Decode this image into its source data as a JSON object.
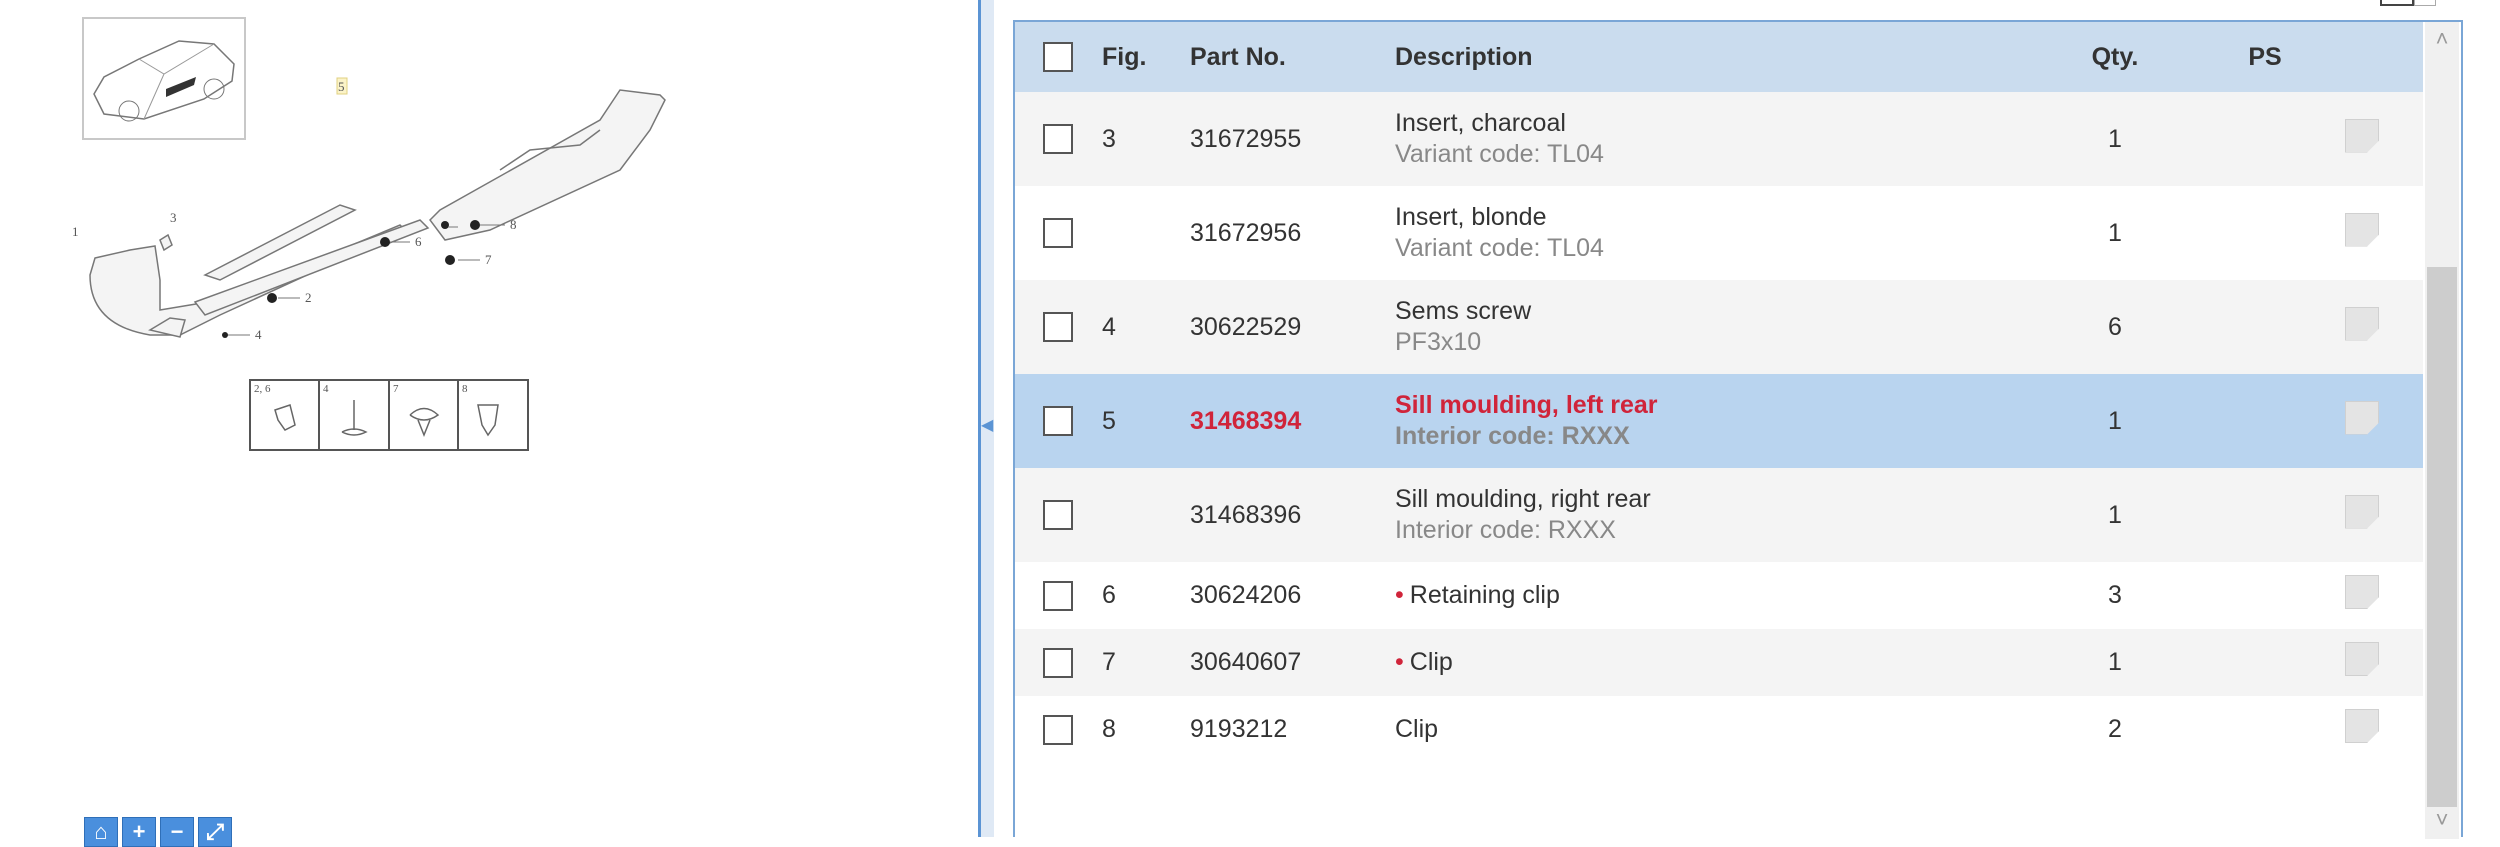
{
  "diagram": {
    "callouts": [
      "1",
      "2",
      "3",
      "4",
      "5",
      "6",
      "7",
      "8"
    ],
    "legend": [
      {
        "label": "2, 6",
        "icon": "retaining-clip-icon"
      },
      {
        "label": "4",
        "icon": "screw-icon"
      },
      {
        "label": "7",
        "icon": "clip-icon"
      },
      {
        "label": "8",
        "icon": "clip-icon"
      }
    ]
  },
  "toolbar": {
    "buttons": [
      {
        "icon": "home-icon",
        "glyph": "⌂"
      },
      {
        "icon": "zoom-in-icon",
        "glyph": "+"
      },
      {
        "icon": "zoom-out-icon",
        "glyph": "−"
      },
      {
        "icon": "fit-icon",
        "glyph": "⤢"
      }
    ]
  },
  "table": {
    "headers": {
      "fig": "Fig.",
      "part_no": "Part No.",
      "description": "Description",
      "qty": "Qty.",
      "ps": "PS"
    },
    "rows": [
      {
        "fig": "3",
        "part_no": "31672955",
        "description": "Insert, charcoal",
        "sub": "Variant code: TL04",
        "qty": "1"
      },
      {
        "fig": "",
        "part_no": "31672956",
        "description": "Insert, blonde",
        "sub": "Variant code: TL04",
        "qty": "1"
      },
      {
        "fig": "4",
        "part_no": "30622529",
        "description": "Sems screw",
        "sub": "PF3x10",
        "qty": "6"
      },
      {
        "fig": "5",
        "part_no": "31468394",
        "description": "Sill moulding, left rear",
        "sub": "Interior code: RXXX",
        "qty": "1",
        "selected": true
      },
      {
        "fig": "",
        "part_no": "31468396",
        "description": "Sill moulding, right rear",
        "sub": "Interior code: RXXX",
        "qty": "1"
      },
      {
        "fig": "6",
        "part_no": "30624206",
        "description": "Retaining clip",
        "bullet": "•",
        "qty": "3"
      },
      {
        "fig": "7",
        "part_no": "30640607",
        "description": "Clip",
        "bullet": "•",
        "qty": "1"
      },
      {
        "fig": "8",
        "part_no": "9193212",
        "description": "Clip",
        "qty": "2"
      }
    ]
  },
  "colors": {
    "accent": "#5b94d4",
    "header_bg": "#cadcee",
    "selected_bg": "#b9d4ef",
    "highlight_text": "#d0243a"
  }
}
